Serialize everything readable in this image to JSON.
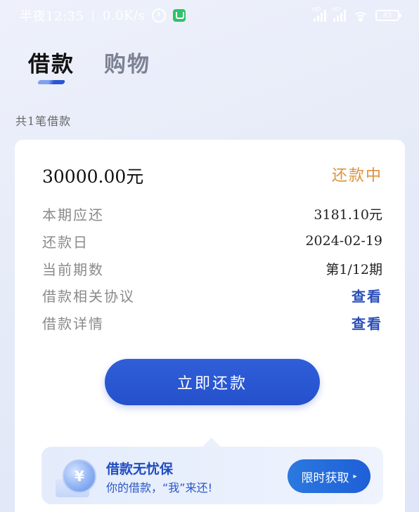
{
  "status_bar": {
    "time": "半夜12:35",
    "separator": "|",
    "network_speed": "0.0K/s",
    "signal_label": "HD",
    "battery": "43"
  },
  "tabs": [
    {
      "label": "借款",
      "active": true
    },
    {
      "label": "购物",
      "active": false
    }
  ],
  "loan_count": "共1笔借款",
  "loan": {
    "amount": "30000.00元",
    "status": "还款中",
    "status_color": "#e0903a",
    "rows": [
      {
        "label": "本期应还",
        "value": "3181.10元"
      },
      {
        "label": "还款日",
        "value": "2024-02-19"
      },
      {
        "label": "当前期数",
        "value": "第1/12期"
      },
      {
        "label": "借款相关协议",
        "value": "查看"
      },
      {
        "label": "借款详情",
        "value": "查看"
      }
    ],
    "repay_button": "立即还款"
  },
  "promo": {
    "coin_symbol": "¥",
    "title": "借款无忧保",
    "subtitle": "你的借款，“我”来还!",
    "button_label": "限时获取",
    "button_arrow": "▸"
  },
  "colors": {
    "accent": "#2550cc",
    "link": "#2b4fb8"
  }
}
